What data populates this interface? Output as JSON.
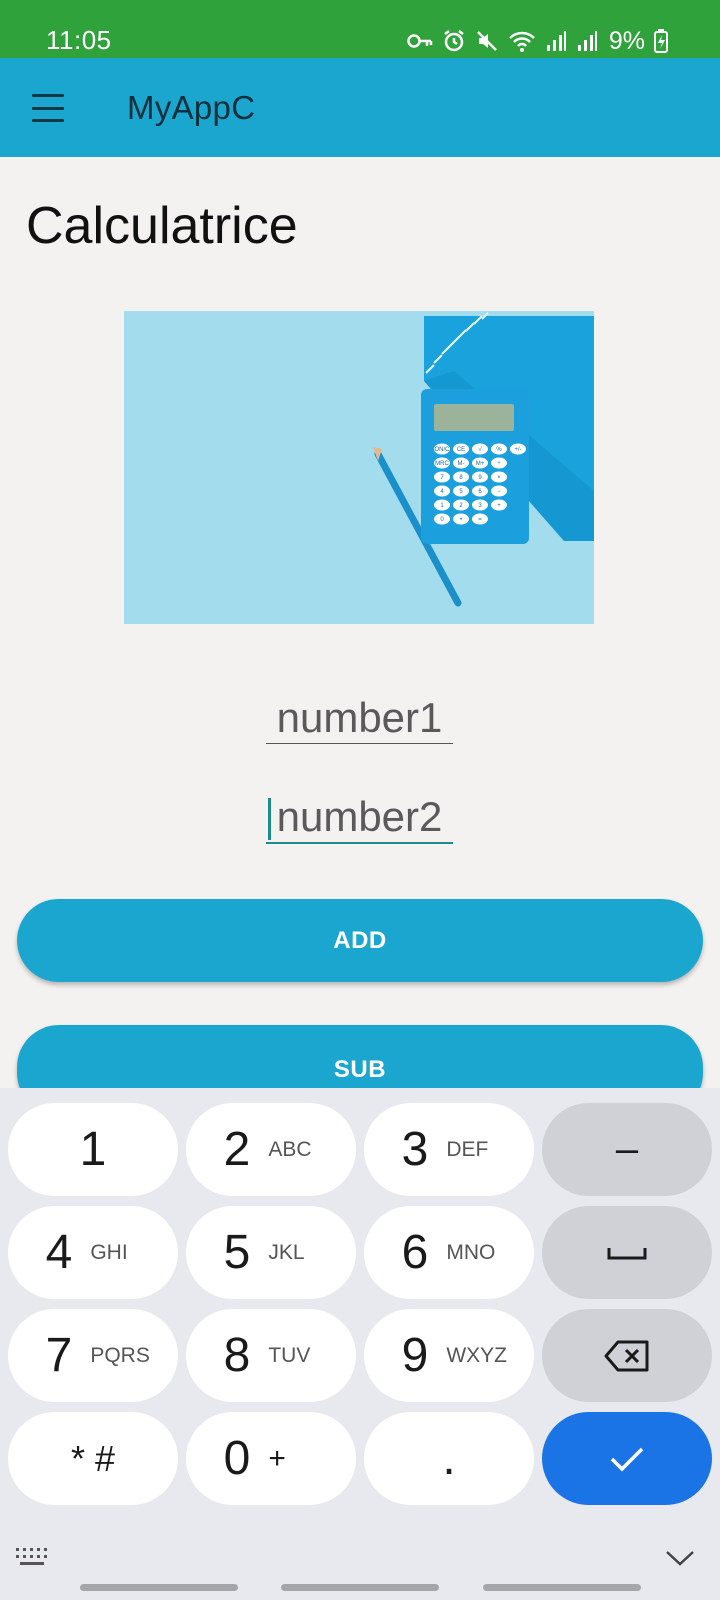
{
  "status_bar": {
    "time": "11:05",
    "battery": "9%"
  },
  "app_bar": {
    "title": "MyAppC"
  },
  "main": {
    "heading": "Calculatrice",
    "number1_placeholder": "number1",
    "number2_placeholder": "number2",
    "add_label": "ADD",
    "sub_label": "SUB"
  },
  "calculator_image": {
    "display_keys": [
      "ON/C",
      "CE",
      "√",
      "%",
      "+/-",
      "MRC",
      "M-",
      "M+",
      "÷",
      "7",
      "8",
      "9",
      "×",
      "4",
      "5",
      "6",
      "−",
      "1",
      "2",
      "3",
      "+",
      "0",
      "•",
      "="
    ]
  },
  "keyboard": {
    "keys": [
      {
        "num": "1",
        "sub": ""
      },
      {
        "num": "2",
        "sub": "ABC"
      },
      {
        "num": "3",
        "sub": "DEF"
      },
      {
        "num": "–",
        "sub": ""
      },
      {
        "num": "4",
        "sub": "GHI"
      },
      {
        "num": "5",
        "sub": "JKL"
      },
      {
        "num": "6",
        "sub": "MNO"
      },
      {
        "num": "␣",
        "sub": ""
      },
      {
        "num": "7",
        "sub": "PQRS"
      },
      {
        "num": "8",
        "sub": "TUV"
      },
      {
        "num": "9",
        "sub": "WXYZ"
      },
      {
        "num": "",
        "sub": ""
      },
      {
        "num": "* #",
        "sub": ""
      },
      {
        "num": "0",
        "sub": "+"
      },
      {
        "num": ".",
        "sub": ""
      },
      {
        "num": "",
        "sub": ""
      }
    ]
  },
  "colors": {
    "status_bar": "#2fa23b",
    "primary": "#1ba6cf",
    "accent_key": "#1b74e6",
    "focus_underline": "#1a8c8c"
  }
}
